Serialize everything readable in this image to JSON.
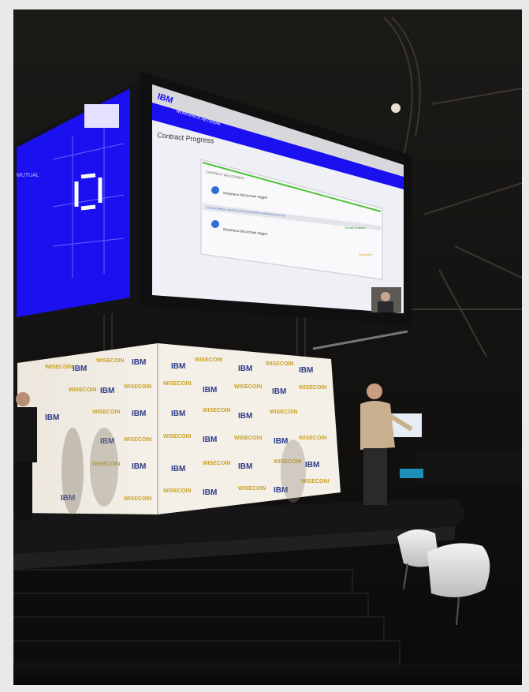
{
  "screen": {
    "logo": "IBM",
    "nav_title": "WORKSPACE NETWORK",
    "page_title": "Contract Progress",
    "section_label": "CONTRACT MILESTONES",
    "event_1": "Morpheus blockchain trigger",
    "event_2": "Morpheus blockchain trigger",
    "status_1": "Visually Available",
    "status_2": "Scheduled",
    "link_text": "Contract Address: 0x0AE6C1A0d7aa9c2e8F9F01aa9C3bE3e7aeC4d5"
  },
  "backdrop": {
    "logo_ibm": "IBM",
    "logo_wisecoin": "WISECOIN"
  },
  "colors": {
    "screen_blue": "#1a10f0",
    "accent_green": "#4ec33b",
    "stage_black": "#0a0a0a"
  }
}
